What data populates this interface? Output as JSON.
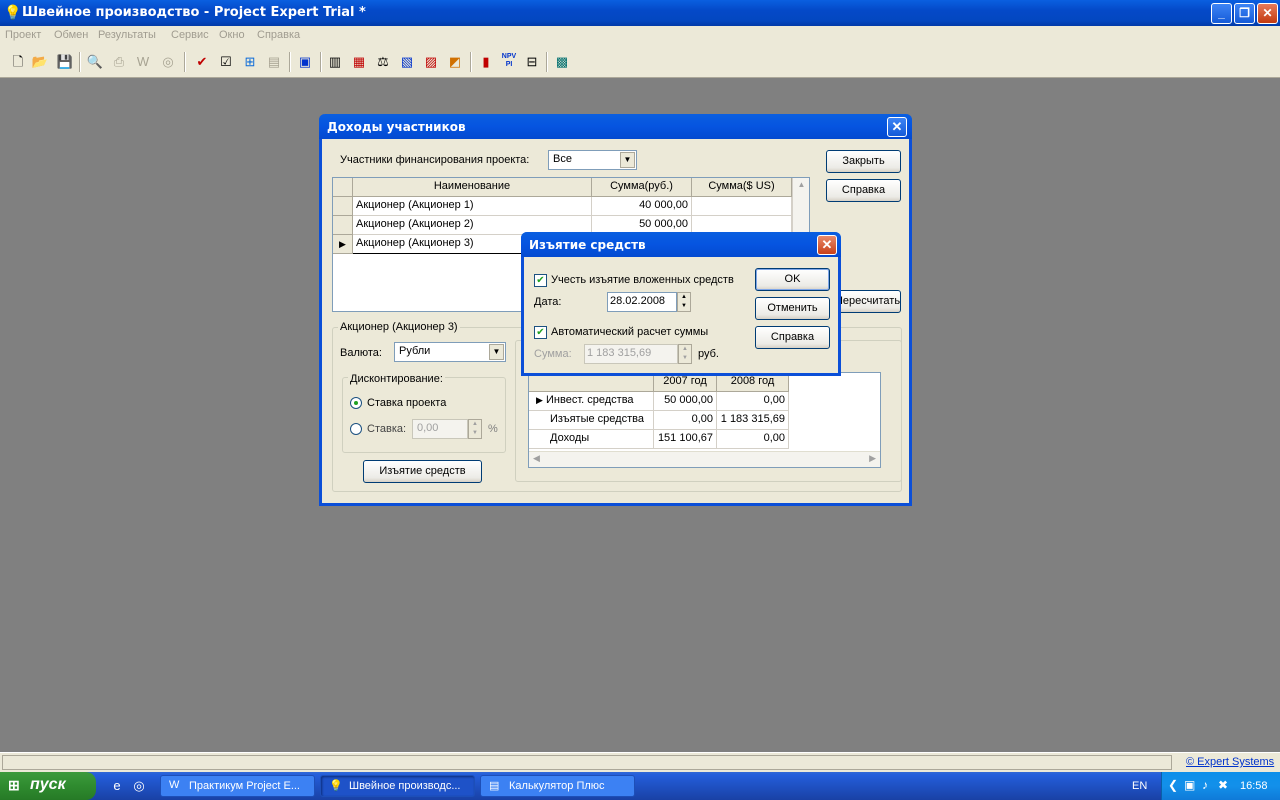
{
  "app": {
    "title": "Швейное производство - Project Expert Trial *",
    "menu": [
      "Проект",
      "Обмен",
      "Результаты",
      "Сервис",
      "Окно",
      "Справка"
    ],
    "status_link": "© Expert Systems"
  },
  "dialog_main": {
    "title": "Доходы участников",
    "participants_label": "Участники финансирования проекта:",
    "participants_value": "Все",
    "close_btn": "Закрыть",
    "help_btn": "Справка",
    "recalc_btn": "Пересчитать",
    "columns": [
      "Наименование",
      "Сумма(руб.)",
      "Сумма($ US)"
    ],
    "rows": [
      {
        "name": "Акционер (Акционер 1)",
        "rub": "40 000,00",
        "usd": ""
      },
      {
        "name": "Акционер (Акционер 2)",
        "rub": "50 000,00",
        "usd": ""
      },
      {
        "name": "Акционер (Акционер 3)",
        "rub": "",
        "usd": ""
      }
    ],
    "group_title": "Акционер (Акционер 3)",
    "currency_label": "Валюта:",
    "currency_value": "Рубли",
    "discount_title": "Дисконтирование:",
    "rate_project": "Ставка проекта",
    "rate_custom": "Ставка:",
    "rate_value": "0,00",
    "rate_unit": "%",
    "withdraw_btn": "Изъятие средств",
    "sub_columns": [
      "2007 год",
      "2008 год"
    ],
    "sub_rows": [
      {
        "name": "Инвест. средства",
        "v2007": "50 000,00",
        "v2008": "0,00"
      },
      {
        "name": "Изъятые средства",
        "v2007": "0,00",
        "v2008": "1 183 315,69"
      },
      {
        "name": "Доходы",
        "v2007": "151 100,67",
        "v2008": "0,00"
      }
    ]
  },
  "dialog_withdraw": {
    "title": "Изъятие средств",
    "consider_label": "Учесть изъятие вложенных средств",
    "date_label": "Дата:",
    "date_value": "28.02.2008",
    "auto_label": "Автоматический расчет суммы",
    "sum_label": "Сумма:",
    "sum_value": "1 183 315,69",
    "sum_unit": "руб.",
    "ok_btn": "OK",
    "cancel_btn": "Отменить",
    "help_btn": "Справка"
  },
  "taskbar": {
    "start": "пуск",
    "tasks": [
      "Практикум Project E...",
      "Швейное производс...",
      "Калькулятор Плюс"
    ],
    "lang": "EN",
    "clock": "16:58"
  }
}
